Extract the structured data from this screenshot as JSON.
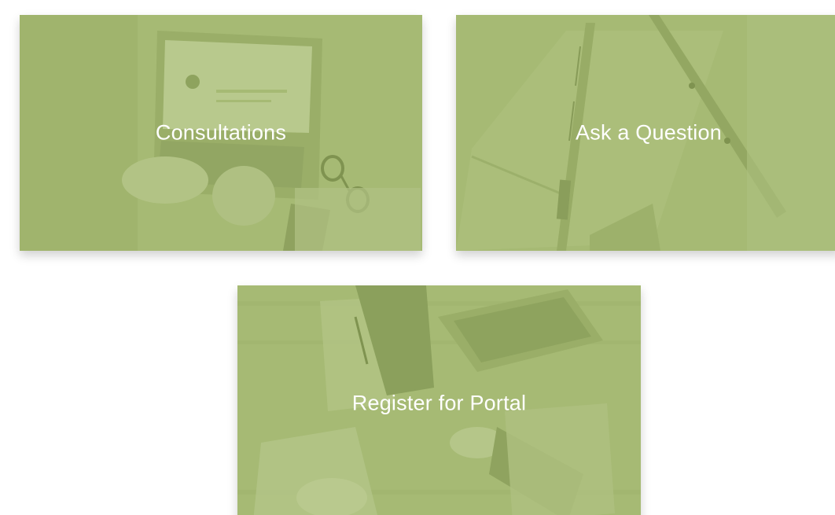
{
  "colors": {
    "tile_overlay": "#a6ba74",
    "label_text": "#ffffff",
    "page_background": "#ffffff"
  },
  "tiles": [
    {
      "label": "Consultations",
      "image": "laptop-desk-photo"
    },
    {
      "label": "Ask a Question",
      "image": "notebook-pens-photo"
    },
    {
      "label": "Register for Portal",
      "image": "handshake-meeting-photo"
    }
  ]
}
